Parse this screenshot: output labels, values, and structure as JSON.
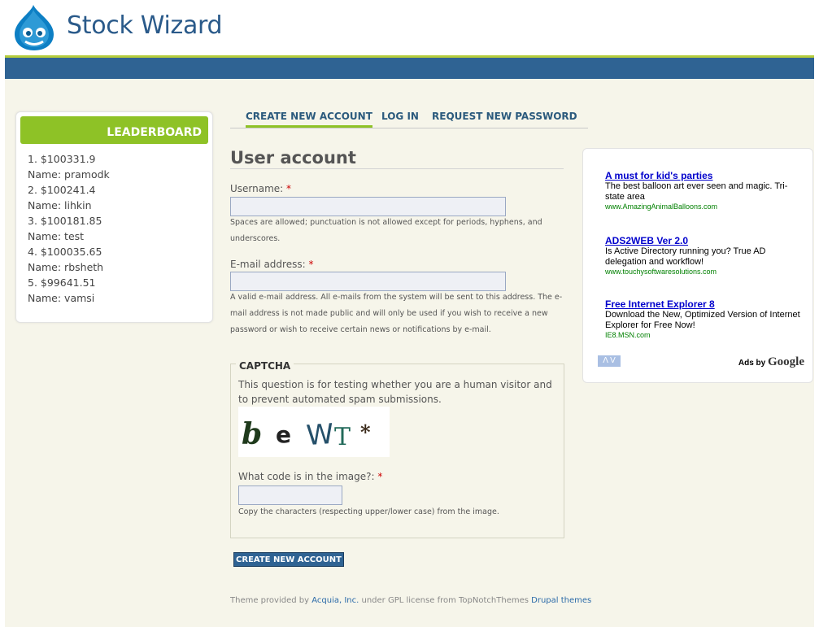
{
  "site": {
    "name": "Stock Wizard"
  },
  "leaderboard": {
    "title": "LEADERBOARD",
    "lines": [
      "1. $100331.9",
      "Name: pramodk",
      "2. $100241.4",
      "Name: lihkin",
      "3. $100181.85",
      "Name: test",
      "4. $100035.65",
      "Name: rbsheth",
      "5. $99641.51",
      "Name: vamsi"
    ]
  },
  "tabs": [
    {
      "label": "CREATE NEW ACCOUNT",
      "active": true
    },
    {
      "label": "LOG IN",
      "active": false
    },
    {
      "label": "REQUEST NEW PASSWORD",
      "active": false
    }
  ],
  "page": {
    "title": "User account"
  },
  "form": {
    "username_label": "Username:",
    "username_value": "",
    "username_desc": "Spaces are allowed; punctuation is not allowed except for periods, hyphens, and underscores.",
    "email_label": "E-mail address:",
    "email_value": "",
    "email_desc": "A valid e-mail address. All e-mails from the system will be sent to this address. The e-mail address is not made public and will only be used if you wish to receive a new password or wish to receive certain news or notifications by e-mail.",
    "required_mark": "*",
    "submit_label": "CREATE NEW ACCOUNT"
  },
  "captcha": {
    "title": "CAPTCHA",
    "description": "This question is for testing whether you are a human visitor and to prevent automated spam submissions.",
    "image_text": "b e W T *",
    "code_label": "What code is in the image?:",
    "code_value": "",
    "code_desc": "Copy the characters (respecting upper/lower case) from the image."
  },
  "ads": [
    {
      "title": "A must for kid's parties",
      "body": "The best balloon art ever seen and magic. Tri-state area",
      "url": "www.AmazingAnimalBalloons.com"
    },
    {
      "title": "ADS2WEB Ver 2.0",
      "body": "Is Active Directory running you? True AD delegation and workflow!",
      "url": "www.touchysoftwaresolutions.com"
    },
    {
      "title": "Free Internet Explorer 8",
      "body": "Download the New, Optimized Version of Internet Explorer for Free Now!",
      "url": "IE8.MSN.com"
    }
  ],
  "ads_by": {
    "prefix": "Ads by",
    "brand": "Google"
  },
  "ad_choice": "Λ V",
  "footer": {
    "prefix": "Theme provided by",
    "link1": "Acquia, Inc.",
    "middle": "under GPL license from TopNotchThemes",
    "link2": "Drupal themes"
  },
  "colors": {
    "brand_blue": "#2f6393",
    "accent_green": "#8ec226",
    "required": "#cc0000"
  }
}
